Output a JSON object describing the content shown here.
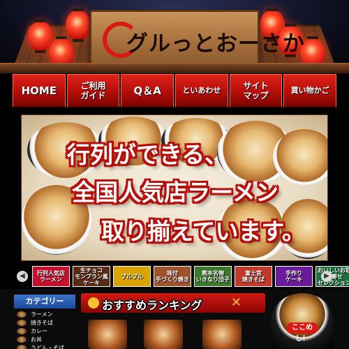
{
  "header": {
    "logo_text": "グルっとおーさか"
  },
  "nav": {
    "items": [
      {
        "line1": "HOME",
        "line2": ""
      },
      {
        "line1": "ご利用",
        "line2": "ガイド"
      },
      {
        "line1": "Q＆A",
        "line2": ""
      },
      {
        "line1": "といあわせ",
        "line2": ""
      },
      {
        "line1": "サイト",
        "line2": "マップ"
      },
      {
        "line1": "買い物かご",
        "line2": ""
      }
    ]
  },
  "hero": {
    "line1": "行列ができる、",
    "line2": "全国人気店ラーメン",
    "line3": "取り揃えています。"
  },
  "categories_strip": {
    "items": [
      {
        "line1": "行列人気店",
        "line2": "ラーメン",
        "color": "#c8102e"
      },
      {
        "line1": "生チョコ",
        "line2": "モンブラン風ケーキ",
        "color": "#5a2a12"
      },
      {
        "line1": "ブルブル",
        "line2": "",
        "color": "#d9a400"
      },
      {
        "line1": "味付",
        "line2": "手づくり焼き",
        "color": "#a0522d"
      },
      {
        "line1": "熊本名物",
        "line2": "いきなり団子",
        "color": "#3a7a2a"
      },
      {
        "line1": "富士宮",
        "line2": "焼きそば",
        "color": "#c0392b"
      },
      {
        "line1": "手作り",
        "line2": "ケーキ",
        "color": "#6a1b9a"
      },
      {
        "line1": "おいしいお取り寄せ",
        "line2": "セレクション",
        "color": "#1f6f3f"
      }
    ]
  },
  "sidebar": {
    "heading": "カテゴリー",
    "items": [
      {
        "label": "ラーメン"
      },
      {
        "label": "焼きそば"
      },
      {
        "label": "カレー"
      },
      {
        "label": "お丼"
      },
      {
        "label": "うどん・そば"
      }
    ]
  },
  "ranking": {
    "heading": "おすすめランキング"
  },
  "promo": {
    "badge": "ここめし！"
  },
  "colors": {
    "nav_red": "#b00c08",
    "heading_blue": "#1c4a9a",
    "hero_outline": "#b5100b"
  }
}
